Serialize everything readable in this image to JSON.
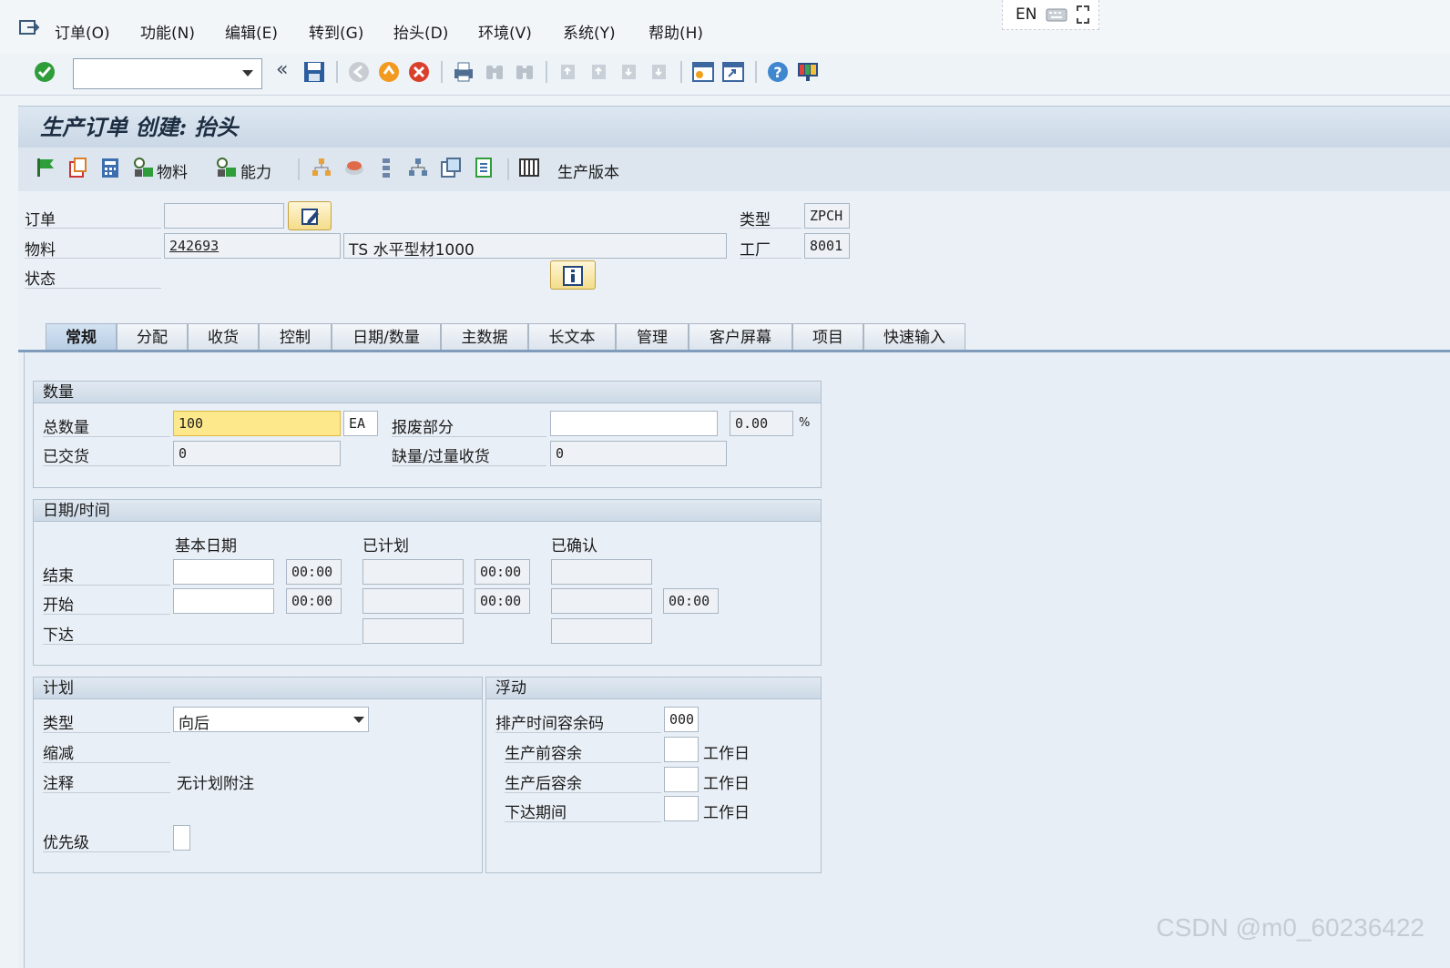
{
  "menu": {
    "items": [
      "订单(O)",
      "功能(N)",
      "编辑(E)",
      "转到(G)",
      "抬头(D)",
      "环境(V)",
      "系统(Y)",
      "帮助(H)"
    ],
    "language": "EN"
  },
  "std_toolbar": {
    "command_field_value": ""
  },
  "title": "生产订单 创建: 抬头",
  "app_toolbar": {
    "material_button": "物料",
    "capacity_button": "能力",
    "prod_version_button": "生产版本"
  },
  "header_fields": {
    "order_label": "订单",
    "order_value": "",
    "material_label": "物料",
    "material_value": "242693",
    "material_desc": "TS 水平型材1000",
    "status_label": "状态",
    "type_label": "类型",
    "type_value": "ZPCH",
    "plant_label": "工厂",
    "plant_value": "8001"
  },
  "tabs": [
    "常规",
    "分配",
    "收货",
    "控制",
    "日期/数量",
    "主数据",
    "长文本",
    "管理",
    "客户屏幕",
    "项目",
    "快速输入"
  ],
  "quantity": {
    "title": "数量",
    "total_label": "总数量",
    "total_value": "100",
    "unit": "EA",
    "scrap_label": "报废部分",
    "scrap_value": "",
    "scrap_percent": "0.00",
    "percent_sign": "%",
    "delivered_label": "已交货",
    "delivered_value": "0",
    "short_label": "缺量/过量收货",
    "short_value": "0"
  },
  "dates": {
    "title": "日期/时间",
    "col_basic": "基本日期",
    "col_planned": "已计划",
    "col_confirmed": "已确认",
    "end_label": "结束",
    "start_label": "开始",
    "release_label": "下达",
    "time_default": "00:00"
  },
  "planning": {
    "title": "计划",
    "type_label": "类型",
    "type_value": "向后",
    "reduction_label": "缩减",
    "note_label": "注释",
    "note_value": "无计划附注",
    "priority_label": "优先级"
  },
  "float": {
    "title": "浮动",
    "sched_margin_label": "排产时间容余码",
    "sched_margin_value": "000",
    "before_label": "生产前容余",
    "after_label": "生产后容余",
    "release_period_label": "下达期间",
    "unit_label": "工作日"
  },
  "watermark": "CSDN @m0_60236422",
  "colors": {
    "focus_field": "#fde98b",
    "tab_active": "#b8cde3",
    "ok_green": "#2e9d3a",
    "cancel_red": "#d9402b"
  }
}
